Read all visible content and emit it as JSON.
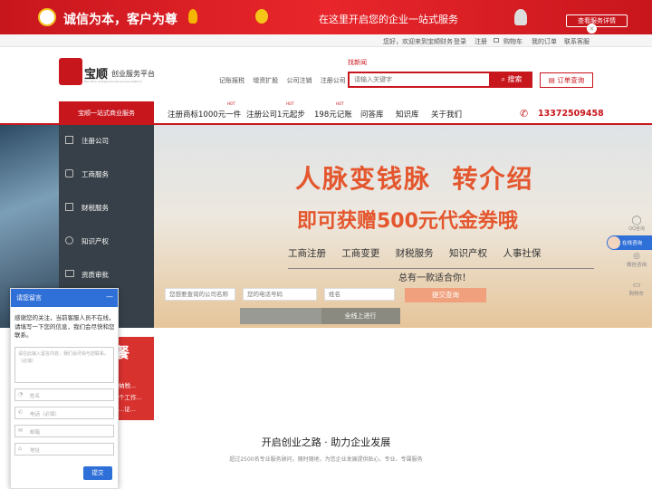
{
  "promo": {
    "slogan": "诚信为本，客户为尊",
    "headline": "在这里开启您的企业一站式服务",
    "cta": "查看服务详情"
  },
  "topbar": {
    "greeting": "您好，欢迎来到宝顺财务",
    "login": "登录",
    "register": "注册",
    "cart": "购物车",
    "orders": "我的订单",
    "contact": "联系客服"
  },
  "header": {
    "logo_text": "宝顺",
    "logo_sub": "创业服务平台",
    "logo_small": "Bao Shun entrepreneurial service platform",
    "hot_link": "找新闻",
    "quick_links": [
      "记账报税",
      "增资扩股",
      "公司注销",
      "注册公司"
    ],
    "search_placeholder": "请输入关键字",
    "search_button": "搜索",
    "order_query": "订单查询"
  },
  "nav": {
    "category_title": "宝顺一站式商业服务",
    "items": [
      {
        "label": "注册商标1000元一件",
        "hot": "HOT"
      },
      {
        "label": "注册公司1元起步",
        "hot": "HOT"
      },
      {
        "label": "198元记账",
        "hot": "HOT"
      },
      {
        "label": "问答库",
        "hot": ""
      },
      {
        "label": "知识库",
        "hot": ""
      },
      {
        "label": "关于我们",
        "hot": ""
      }
    ],
    "phone": "13372509458"
  },
  "sidebar": {
    "items": [
      "注册公司",
      "工商服务",
      "财税服务",
      "知识产权",
      "资质审批"
    ]
  },
  "banner": {
    "line1": "人脉变钱脉  转介绍",
    "line2": "即可获赠500元代金券哦",
    "services": [
      "工商注册",
      "工商变更",
      "财税服务",
      "知识产权",
      "人事社保"
    ],
    "tagline": "总有一款适合你！",
    "company_placeholder": "您想要查询的公司名称",
    "phone_placeholder": "您的电话号码",
    "name_placeholder": "姓名",
    "submit": "提交查询",
    "online_btn": "全线上进行"
  },
  "chat": {
    "title": "请您留言",
    "message": "感谢您的关注，当前客服人员不在线，请填写一下您的信息，我们会尽快和您联系。",
    "textarea_placeholder": "请在此输入留言内容，我们会尽快与您联系。（必填）",
    "name_placeholder": "姓名",
    "phone_placeholder": "电话（必填）",
    "email_placeholder": "邮箱",
    "address_placeholder": "地址",
    "submit": "提交"
  },
  "side_peek": {
    "title": "餐",
    "lines": [
      "纳税...",
      "个工作...",
      "...证..."
    ]
  },
  "right_tools": {
    "items": [
      "QQ咨询",
      "在线咨询",
      "微信咨询",
      "购物车"
    ]
  },
  "section": {
    "title": "开启创业之路 · 助力企业发展",
    "subtitle": "超过2500名专业服务顾问，随时随地，为您企业发展提供贴心、专业、专属服务"
  }
}
